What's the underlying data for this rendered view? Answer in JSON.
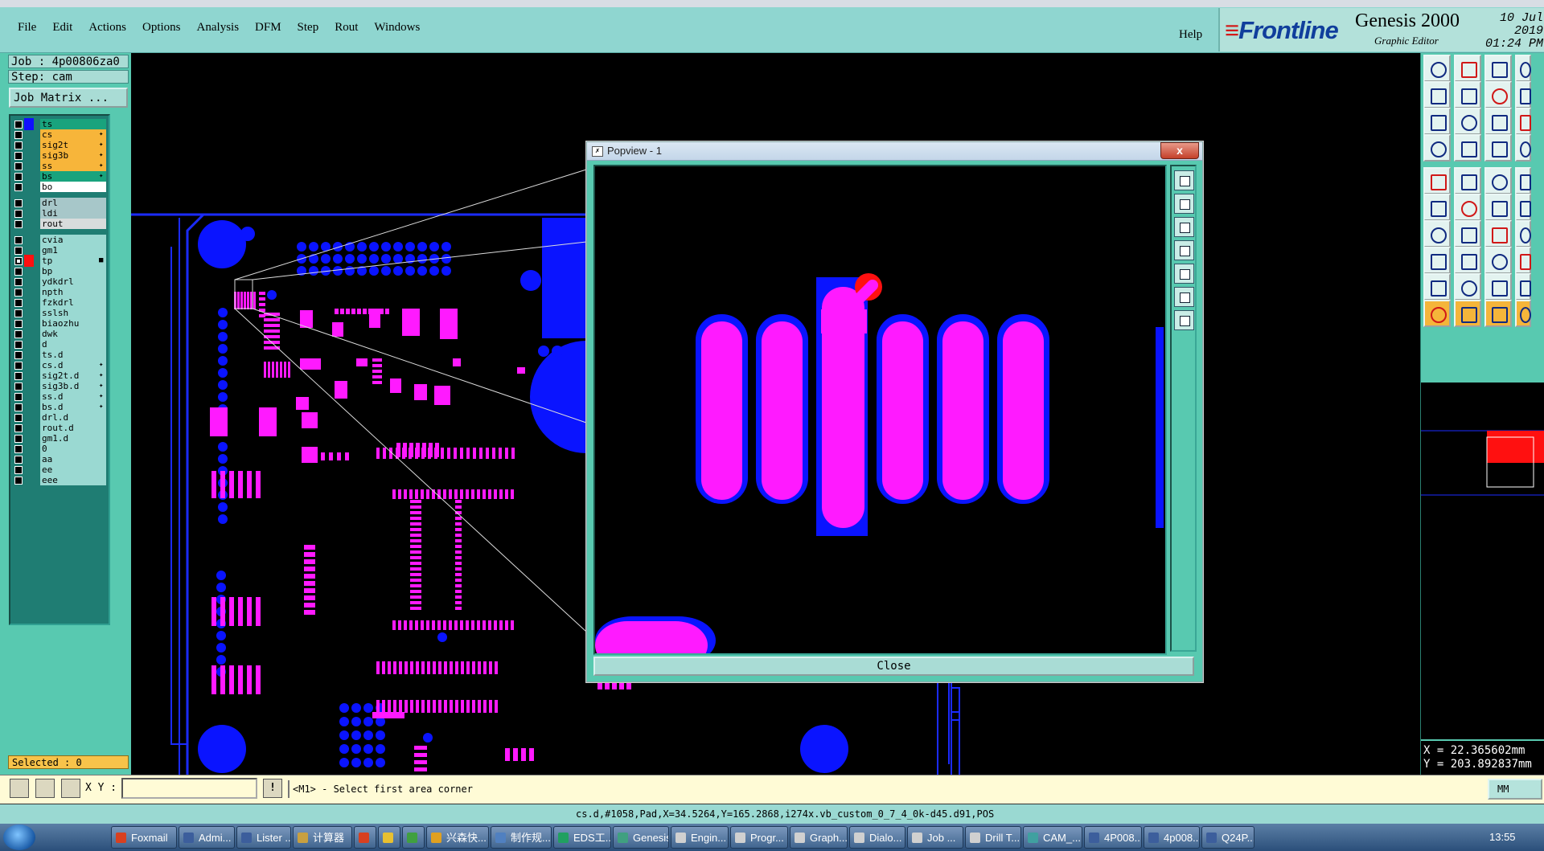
{
  "menubar": {
    "menus": [
      "File",
      "Edit",
      "Actions",
      "Options",
      "Analysis",
      "DFM",
      "Step",
      "Rout",
      "Windows"
    ],
    "help": "Help"
  },
  "brand": {
    "logo": "Frontline",
    "product": "Genesis 2000",
    "subtitle": "Graphic Editor",
    "date": "10 Jul 2019",
    "time": "01:24 PM"
  },
  "job": {
    "job_label": "Job : 4p00806za0",
    "step_label": "Step: cam",
    "matrix_button": "Job Matrix ..."
  },
  "layers": [
    {
      "name": "ts",
      "color": "#19a37d",
      "swatch": "#1010ff",
      "checked": false,
      "flag": ""
    },
    {
      "name": "cs",
      "color": "#f7b53a",
      "swatch": "",
      "checked": false,
      "flag": "✦"
    },
    {
      "name": "sig2t",
      "color": "#f7b53a",
      "swatch": "",
      "checked": false,
      "flag": "✦"
    },
    {
      "name": "sig3b",
      "color": "#f7b53a",
      "swatch": "",
      "checked": false,
      "flag": "✦"
    },
    {
      "name": "ss",
      "color": "#f7b53a",
      "swatch": "",
      "checked": false,
      "flag": "✦"
    },
    {
      "name": "bs",
      "color": "#19a37d",
      "swatch": "",
      "checked": false,
      "flag": "✦"
    },
    {
      "name": "bo",
      "color": "#ffffff",
      "swatch": "",
      "checked": false,
      "flag": ""
    },
    {
      "name": "drl",
      "color": "#a7c7c9",
      "swatch": "",
      "checked": false,
      "flag": ""
    },
    {
      "name": "ldi",
      "color": "#a7c7c9",
      "swatch": "",
      "checked": false,
      "flag": ""
    },
    {
      "name": "rout",
      "color": "#d8dcdc",
      "swatch": "",
      "checked": false,
      "flag": ""
    },
    {
      "name": "cvia",
      "color": "#9ad9d2",
      "swatch": "",
      "checked": false,
      "flag": ""
    },
    {
      "name": "gm1",
      "color": "#9ad9d2",
      "swatch": "",
      "checked": false,
      "flag": ""
    },
    {
      "name": "tp",
      "color": "#9ad9d2",
      "swatch": "#ff1010",
      "checked": true,
      "flag": "■"
    },
    {
      "name": "bp",
      "color": "#9ad9d2",
      "swatch": "",
      "checked": false,
      "flag": ""
    },
    {
      "name": "ydkdrl",
      "color": "#9ad9d2",
      "swatch": "",
      "checked": false,
      "flag": ""
    },
    {
      "name": "npth",
      "color": "#9ad9d2",
      "swatch": "",
      "checked": false,
      "flag": ""
    },
    {
      "name": "fzkdrl",
      "color": "#9ad9d2",
      "swatch": "",
      "checked": false,
      "flag": ""
    },
    {
      "name": "sslsh",
      "color": "#9ad9d2",
      "swatch": "",
      "checked": false,
      "flag": ""
    },
    {
      "name": "biaozhu",
      "color": "#9ad9d2",
      "swatch": "",
      "checked": false,
      "flag": ""
    },
    {
      "name": "dwk",
      "color": "#9ad9d2",
      "swatch": "",
      "checked": false,
      "flag": ""
    },
    {
      "name": "d",
      "color": "#9ad9d2",
      "swatch": "",
      "checked": false,
      "flag": ""
    },
    {
      "name": "ts.d",
      "color": "#9ad9d2",
      "swatch": "",
      "checked": false,
      "flag": ""
    },
    {
      "name": "cs.d",
      "color": "#9ad9d2",
      "swatch": "",
      "checked": false,
      "flag": "✦"
    },
    {
      "name": "sig2t.d",
      "color": "#9ad9d2",
      "swatch": "",
      "checked": false,
      "flag": "✦"
    },
    {
      "name": "sig3b.d",
      "color": "#9ad9d2",
      "swatch": "",
      "checked": false,
      "flag": "✦"
    },
    {
      "name": "ss.d",
      "color": "#9ad9d2",
      "swatch": "",
      "checked": false,
      "flag": "✦"
    },
    {
      "name": "bs.d",
      "color": "#9ad9d2",
      "swatch": "",
      "checked": false,
      "flag": "✦"
    },
    {
      "name": "drl.d",
      "color": "#9ad9d2",
      "swatch": "",
      "checked": false,
      "flag": ""
    },
    {
      "name": "rout.d",
      "color": "#9ad9d2",
      "swatch": "",
      "checked": false,
      "flag": ""
    },
    {
      "name": "gm1.d",
      "color": "#9ad9d2",
      "swatch": "",
      "checked": false,
      "flag": ""
    },
    {
      "name": "0",
      "color": "#9ad9d2",
      "swatch": "",
      "checked": false,
      "flag": ""
    },
    {
      "name": "aa",
      "color": "#9ad9d2",
      "swatch": "",
      "checked": false,
      "flag": ""
    },
    {
      "name": "ee",
      "color": "#9ad9d2",
      "swatch": "",
      "checked": false,
      "flag": ""
    },
    {
      "name": "eee",
      "color": "#9ad9d2",
      "swatch": "",
      "checked": false,
      "flag": ""
    }
  ],
  "selected": "Selected : 0",
  "popview": {
    "title": "Popview - 1",
    "close_button": "Close",
    "close_glyph": "x"
  },
  "coords": {
    "x": "X = 22.365602mm",
    "y": "Y = 203.892837mm"
  },
  "commandbar": {
    "xy_label": "X Y :",
    "xy_value": "",
    "prompt": "<M1> - Select first area corner",
    "units": "MM"
  },
  "status": "cs.d,#1058,Pad,X=34.5264,Y=165.2868,i274x.vb_custom_0_7_4_0k-d45.d91,POS",
  "taskbar": {
    "items": [
      "Foxmail",
      "Admi...",
      "Lister ...",
      "计算器",
      "",
      "",
      "",
      "兴森快...",
      "制作规...",
      "EDS工...",
      "Genesis",
      "Engin...",
      "Progr...",
      "Graph...",
      "Dialo...",
      "Job ...",
      "Drill T...",
      "CAM_...",
      "4P008...",
      "4p008...",
      "Q24P..."
    ],
    "clock": "13:55"
  },
  "colors": {
    "pad": "#ff1aff",
    "copper": "#0a14ff",
    "highlight": "#ff1010",
    "panel": "#58c9b0",
    "menubar": "#8fd6d0"
  }
}
